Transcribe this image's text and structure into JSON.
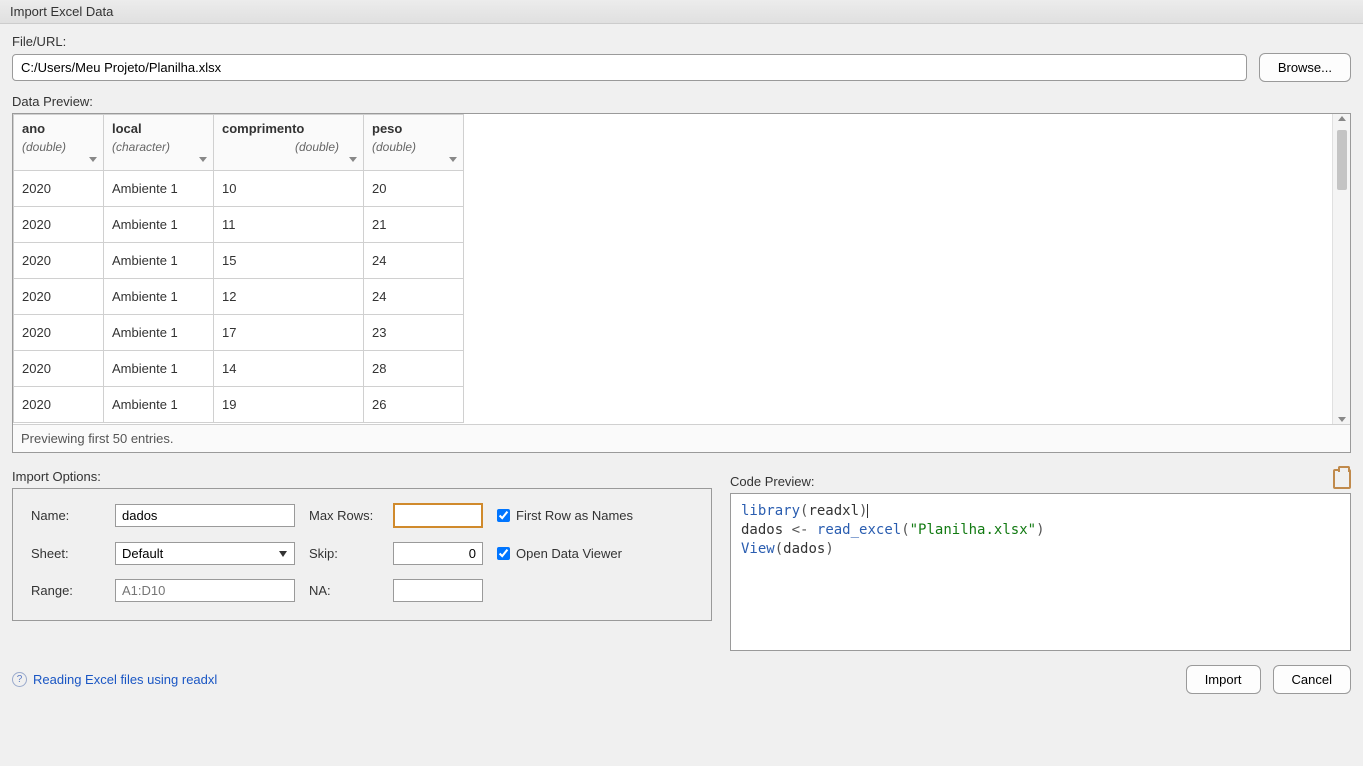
{
  "window": {
    "title": "Import Excel Data"
  },
  "fileurl": {
    "label": "File/URL:",
    "value": "C:/Users/Meu Projeto/Planilha.xlsx",
    "browse": "Browse..."
  },
  "preview": {
    "label": "Data Preview:",
    "footer": "Previewing first 50 entries.",
    "columns": [
      {
        "name": "ano",
        "type": "(double)"
      },
      {
        "name": "local",
        "type": "(character)"
      },
      {
        "name": "comprimento",
        "type": "(double)"
      },
      {
        "name": "peso",
        "type": "(double)"
      }
    ],
    "rows": [
      {
        "ano": "2020",
        "local": "Ambiente 1",
        "comprimento": "10",
        "peso": "20"
      },
      {
        "ano": "2020",
        "local": "Ambiente 1",
        "comprimento": "11",
        "peso": "21"
      },
      {
        "ano": "2020",
        "local": "Ambiente 1",
        "comprimento": "15",
        "peso": "24"
      },
      {
        "ano": "2020",
        "local": "Ambiente 1",
        "comprimento": "12",
        "peso": "24"
      },
      {
        "ano": "2020",
        "local": "Ambiente 1",
        "comprimento": "17",
        "peso": "23"
      },
      {
        "ano": "2020",
        "local": "Ambiente 1",
        "comprimento": "14",
        "peso": "28"
      },
      {
        "ano": "2020",
        "local": "Ambiente 1",
        "comprimento": "19",
        "peso": "26"
      }
    ]
  },
  "options": {
    "heading": "Import Options:",
    "name_label": "Name:",
    "name_value": "dados",
    "sheet_label": "Sheet:",
    "sheet_value": "Default",
    "range_label": "Range:",
    "range_placeholder": "A1:D10",
    "maxrows_label": "Max Rows:",
    "maxrows_value": "",
    "skip_label": "Skip:",
    "skip_value": "0",
    "na_label": "NA:",
    "na_value": "",
    "first_row_label": "First Row as Names",
    "open_viewer_label": "Open Data Viewer"
  },
  "code": {
    "heading": "Code Preview:",
    "library_kw": "library",
    "library_arg": "readxl",
    "assign_lhs": "dados",
    "assign_op": "<-",
    "read_fn": "read_excel",
    "read_arg": "\"Planilha.xlsx\"",
    "view_fn": "View",
    "view_arg": "dados"
  },
  "footer": {
    "help_text": "Reading Excel files using readxl",
    "import": "Import",
    "cancel": "Cancel"
  }
}
